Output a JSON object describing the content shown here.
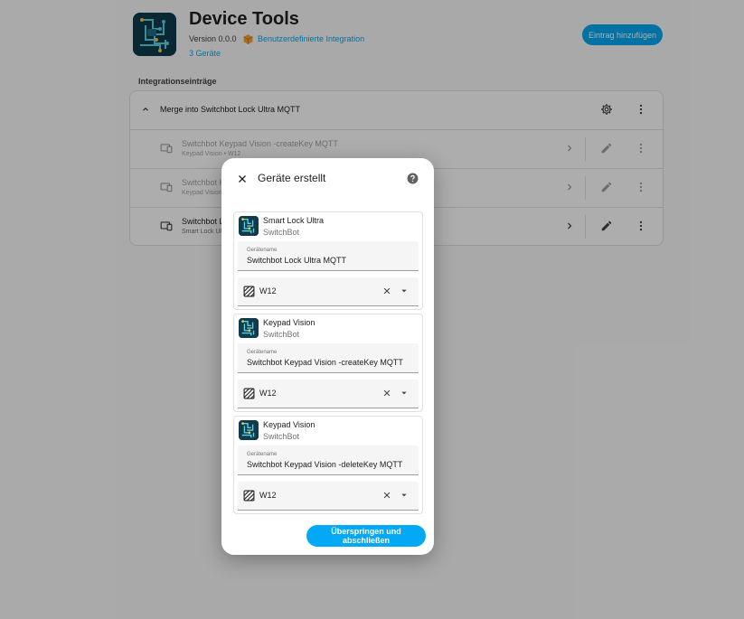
{
  "header": {
    "title": "Device Tools",
    "version": "Version 0.0.0",
    "custom_integration": "Benutzerdefinierte Integration",
    "devices_count": "3 Geräte",
    "add_entry": "Eintrag hinzufügen"
  },
  "section_heading": "Integrationseinträge",
  "entry": {
    "title": "Merge into Switchbot Lock Ultra MQTT",
    "rows": [
      {
        "title": "Switchbot Keypad Vision -createKey MQTT",
        "sub": "Keypad Vision • W12"
      },
      {
        "title": "Switchbot K",
        "sub": "Keypad Vision"
      },
      {
        "title": "Switchbot Lo",
        "sub": "Smart Lock Ul"
      }
    ]
  },
  "dialog": {
    "title": "Geräte erstellt",
    "name_label": "Gerätename",
    "devices": [
      {
        "model": "Smart Lock Ultra",
        "manufacturer": "SwitchBot",
        "name": "Switchbot Lock Ultra MQTT",
        "area": "W12"
      },
      {
        "model": "Keypad Vision",
        "manufacturer": "SwitchBot",
        "name": "Switchbot Keypad Vision -createKey MQTT",
        "area": "W12"
      },
      {
        "model": "Keypad Vision",
        "manufacturer": "SwitchBot",
        "name": "Switchbot Keypad Vision -deleteKey MQTT",
        "area": "W12"
      }
    ],
    "finish_button": "Überspringen und abschließen"
  },
  "colors": {
    "accent": "#03a9f4",
    "logo_bg": "#0f3b4d",
    "scrim": "rgba(0,0,0,0.32)"
  },
  "icons": {
    "logo": "circuit-logo-icon",
    "custom_integration": "package-icon",
    "collapse": "chevron-up-icon",
    "settings": "gear-icon",
    "more": "dots-vertical-icon",
    "device": "devices-icon",
    "chevron": "chevron-right-icon",
    "edit": "pencil-icon",
    "close": "close-icon",
    "help": "help-circle-icon",
    "area": "texture-box-icon",
    "clear": "close-icon",
    "dropdown": "menu-down-icon"
  }
}
